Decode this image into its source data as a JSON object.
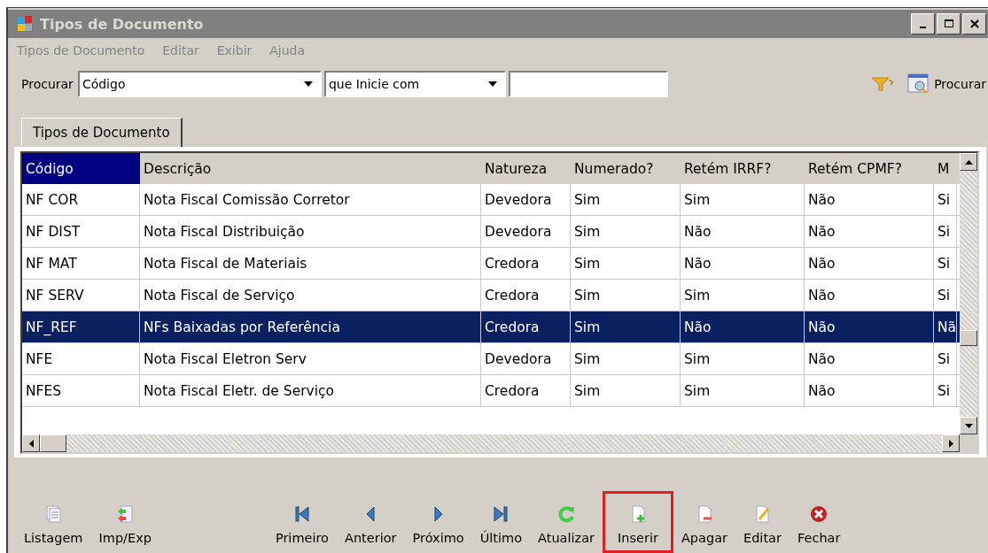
{
  "window": {
    "title": "Tipos de Documento"
  },
  "menu": [
    "Tipos de Documento",
    "Editar",
    "Exibir",
    "Ajuda"
  ],
  "search": {
    "label": "Procurar",
    "field": "Código",
    "operator": "que Inicie com",
    "button": "Procurar"
  },
  "tabs": [
    {
      "label": "Tipos de Documento",
      "selected": true
    }
  ],
  "table": {
    "columns": [
      {
        "label": "Código",
        "selected": true
      },
      {
        "label": "Descrição",
        "selected": false
      },
      {
        "label": "Natureza",
        "selected": false
      },
      {
        "label": "Numerado?",
        "selected": false
      },
      {
        "label": "Retém IRRF?",
        "selected": false
      },
      {
        "label": "Retém CPMF?",
        "selected": false
      },
      {
        "label": "M",
        "selected": false
      }
    ],
    "rows": [
      {
        "selected": false,
        "cells": [
          "NF COR",
          "Nota Fiscal Comissão Corretor",
          "Devedora",
          "Sim",
          "Sim",
          "Não",
          "Si"
        ]
      },
      {
        "selected": false,
        "cells": [
          "NF DIST",
          "Nota Fiscal Distribuição",
          "Devedora",
          "Sim",
          "Não",
          "Não",
          "Si"
        ]
      },
      {
        "selected": false,
        "cells": [
          "NF MAT",
          "Nota Fiscal de Materiais",
          "Credora",
          "Sim",
          "Não",
          "Não",
          "Si"
        ]
      },
      {
        "selected": false,
        "cells": [
          "NF SERV",
          "Nota Fiscal de Serviço",
          "Credora",
          "Sim",
          "Sim",
          "Não",
          "Si"
        ]
      },
      {
        "selected": true,
        "cells": [
          "NF_REF",
          "NFs Baixadas por Referência",
          "Credora",
          "Sim",
          "Não",
          "Não",
          "Nã"
        ]
      },
      {
        "selected": false,
        "cells": [
          "NFE",
          "Nota Fiscal Eletron Serv",
          "Devedora",
          "Sim",
          "Sim",
          "Não",
          "Si"
        ]
      },
      {
        "selected": false,
        "cells": [
          "NFES",
          "Nota Fiscal Eletr. de Serviço",
          "Credora",
          "Sim",
          "Sim",
          "Não",
          "Si"
        ]
      }
    ]
  },
  "toolbar": [
    {
      "kind": "list",
      "label": "Listagem",
      "highlighted": false
    },
    {
      "kind": "impexp",
      "label": "Imp/Exp",
      "highlighted": false
    },
    {
      "kind": "spacer"
    },
    {
      "kind": "first",
      "label": "Primeiro",
      "highlighted": false
    },
    {
      "kind": "prev",
      "label": "Anterior",
      "highlighted": false
    },
    {
      "kind": "next",
      "label": "Próximo",
      "highlighted": false
    },
    {
      "kind": "last",
      "label": "Último",
      "highlighted": false
    },
    {
      "kind": "refresh",
      "label": "Atualizar",
      "highlighted": false
    },
    {
      "kind": "insert",
      "label": "Inserir",
      "highlighted": true
    },
    {
      "kind": "delete",
      "label": "Apagar",
      "highlighted": false
    },
    {
      "kind": "edit",
      "label": "Editar",
      "highlighted": false
    },
    {
      "kind": "close",
      "label": "Fechar",
      "highlighted": false
    }
  ]
}
